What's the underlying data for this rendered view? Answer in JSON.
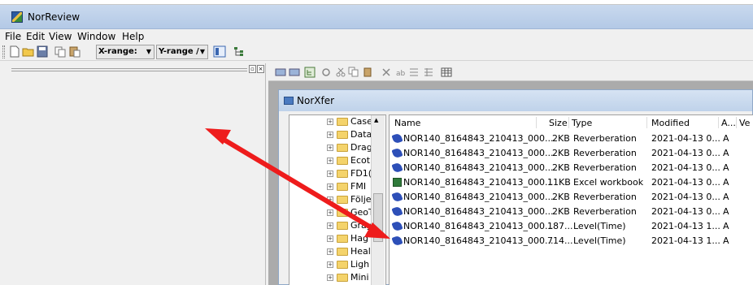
{
  "app": {
    "title": "NorReview"
  },
  "menu": [
    "File",
    "Edit",
    "View",
    "Window",
    "Help"
  ],
  "toolbar": {
    "x_range": "X-range:",
    "y_range": "Y-range /"
  },
  "child_window": {
    "title": "NorXfer"
  },
  "tree": {
    "items": [
      "Case",
      "Data",
      "Drag",
      "Ecot",
      "FD1(",
      "FMI",
      "Följe",
      "GeoT",
      "Gray",
      "Hag",
      "Heal",
      "Ligh",
      "Mini"
    ]
  },
  "file_list": {
    "columns": [
      "Name",
      "Size",
      "Type",
      "Modified",
      "A...",
      "Ve"
    ],
    "rows": [
      {
        "name": "NOR140_8164843_210413_000...",
        "size": "2KB",
        "type": "Reverberation",
        "modified": "2021-04-13 0...",
        "attr": "A",
        "icon": "reverb-file-icon"
      },
      {
        "name": "NOR140_8164843_210413_000...",
        "size": "2KB",
        "type": "Reverberation",
        "modified": "2021-04-13 0...",
        "attr": "A",
        "icon": "reverb-file-icon"
      },
      {
        "name": "NOR140_8164843_210413_000...",
        "size": "2KB",
        "type": "Reverberation",
        "modified": "2021-04-13 0...",
        "attr": "A",
        "icon": "reverb-file-icon"
      },
      {
        "name": "NOR140_8164843_210413_000...",
        "size": "11KB",
        "type": "Excel workbook",
        "modified": "2021-04-13 0...",
        "attr": "A",
        "icon": "excel-file-icon"
      },
      {
        "name": "NOR140_8164843_210413_000...",
        "size": "2KB",
        "type": "Reverberation",
        "modified": "2021-04-13 0...",
        "attr": "A",
        "icon": "reverb-file-icon"
      },
      {
        "name": "NOR140_8164843_210413_000...",
        "size": "2KB",
        "type": "Reverberation",
        "modified": "2021-04-13 0...",
        "attr": "A",
        "icon": "reverb-file-icon"
      },
      {
        "name": "NOR140_8164843_210413_000...",
        "size": "187...",
        "type": "Level(Time)",
        "modified": "2021-04-13 1...",
        "attr": "A",
        "icon": "level-file-icon"
      },
      {
        "name": "NOR140_8164843_210413_000...",
        "size": "714...",
        "type": "Level(Time)",
        "modified": "2021-04-13 1...",
        "attr": "A",
        "icon": "level-file-icon"
      }
    ]
  },
  "colors": {
    "arrow": "#ee1c1c",
    "titlebar": "#b9cde8"
  }
}
